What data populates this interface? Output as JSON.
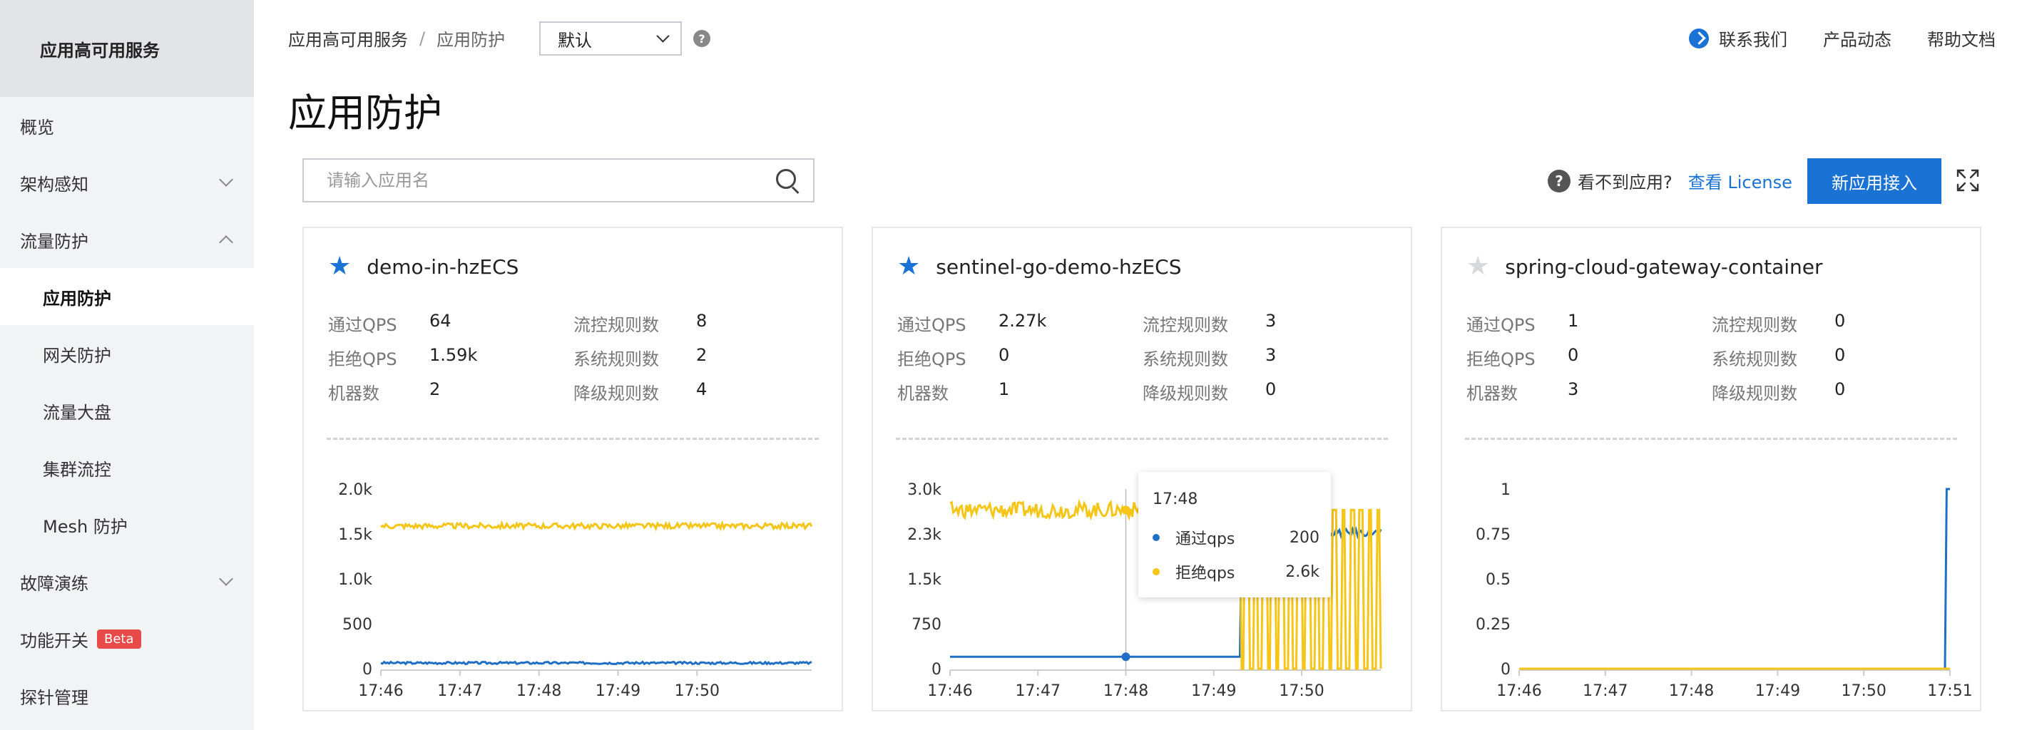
{
  "sidebar": {
    "title": "应用高可用服务",
    "items": [
      {
        "label": "概览",
        "type": "top"
      },
      {
        "label": "架构感知",
        "type": "group",
        "state": "collapsed"
      },
      {
        "label": "流量防护",
        "type": "group",
        "state": "expanded"
      },
      {
        "label": "应用防护",
        "type": "sub",
        "active": true
      },
      {
        "label": "网关防护",
        "type": "sub"
      },
      {
        "label": "流量大盘",
        "type": "sub"
      },
      {
        "label": "集群流控",
        "type": "sub"
      },
      {
        "label": "Mesh 防护",
        "type": "sub"
      },
      {
        "label": "故障演练",
        "type": "group",
        "state": "collapsed"
      },
      {
        "label": "功能开关",
        "type": "top",
        "badge": "Beta"
      },
      {
        "label": "探针管理",
        "type": "top"
      }
    ]
  },
  "header": {
    "breadcrumb": [
      "应用高可用服务",
      "应用防护"
    ],
    "breadcrumb_sep": "/",
    "region_select": "默认",
    "links": [
      "联系我们",
      "产品动态",
      "帮助文档"
    ]
  },
  "page": {
    "title": "应用防护",
    "search_placeholder": "请输入应用名",
    "cant_see_text": "看不到应用?",
    "license_link": "查看 License",
    "add_app_button": "新应用接入"
  },
  "colors": {
    "accent": "#1a73d4",
    "pass_series": "#1f6fc5",
    "reject_series": "#f5c518",
    "beta_badge": "#e84a4a"
  },
  "card_labels": {
    "pass_qps": "通过QPS",
    "reject_qps": "拒绝QPS",
    "machines": "机器数",
    "flow_rules": "流控规则数",
    "system_rules": "系统规则数",
    "degrade_rules": "降级规则数"
  },
  "cards": [
    {
      "name": "demo-in-hzECS",
      "favorite": true,
      "pass_qps": "64",
      "reject_qps": "1.59k",
      "machines": "2",
      "flow_rules": "8",
      "system_rules": "2",
      "degrade_rules": "4"
    },
    {
      "name": "sentinel-go-demo-hzECS",
      "favorite": true,
      "pass_qps": "2.27k",
      "reject_qps": "0",
      "machines": "1",
      "flow_rules": "3",
      "system_rules": "3",
      "degrade_rules": "0"
    },
    {
      "name": "spring-cloud-gateway-container",
      "favorite": false,
      "pass_qps": "1",
      "reject_qps": "0",
      "machines": "3",
      "flow_rules": "0",
      "system_rules": "0",
      "degrade_rules": "0"
    }
  ],
  "chart_data": [
    {
      "type": "line",
      "x_ticks": [
        "17:46",
        "17:47",
        "17:48",
        "17:49",
        "17:50"
      ],
      "y_ticks": [
        "0",
        "500",
        "1.0k",
        "1.5k",
        "2.0k"
      ],
      "ylim": [
        0,
        2000
      ],
      "x_range_minutes": [
        0,
        5.45
      ],
      "series": [
        {
          "name": "通过qps",
          "color": "#1f6fc5",
          "base": 64,
          "noise": 12,
          "segments": []
        },
        {
          "name": "拒绝qps",
          "color": "#f5c518",
          "base": 1590,
          "noise": 30,
          "segments": []
        }
      ]
    },
    {
      "type": "line",
      "x_ticks": [
        "17:46",
        "17:47",
        "17:48",
        "17:49",
        "17:50"
      ],
      "y_ticks": [
        "0",
        "750",
        "1.5k",
        "2.3k",
        "3.0k"
      ],
      "ylim": [
        0,
        3000
      ],
      "x_range_minutes": [
        0,
        4.9
      ],
      "tooltip": {
        "time": "17:48",
        "rows": [
          {
            "name": "通过qps",
            "value": "200",
            "color": "#1f6fc5"
          },
          {
            "name": "拒绝qps",
            "value": "2.6k",
            "color": "#f5c518"
          }
        ]
      },
      "series": [
        {
          "name": "通过qps",
          "color": "#1f6fc5",
          "pattern": "low-then-high",
          "low": 200,
          "high": 2270,
          "switch_minute": 3.3
        },
        {
          "name": "拒绝qps",
          "color": "#f5c518",
          "pattern": "high-then-oscillate",
          "high": 2650,
          "switch_minute": 3.3
        }
      ]
    },
    {
      "type": "line",
      "x_ticks": [
        "17:46",
        "17:47",
        "17:48",
        "17:49",
        "17:50",
        "17:51"
      ],
      "y_ticks": [
        "0",
        "0.25",
        "0.5",
        "0.75",
        "1"
      ],
      "ylim": [
        0,
        1
      ],
      "x_range_minutes": [
        0,
        5
      ],
      "series": [
        {
          "name": "通过qps",
          "color": "#1f6fc5",
          "pattern": "spike-end",
          "spike_minute": 4.95,
          "value": 1
        },
        {
          "name": "拒绝qps",
          "color": "#f5c518",
          "pattern": "flat",
          "value": 0
        }
      ]
    }
  ]
}
